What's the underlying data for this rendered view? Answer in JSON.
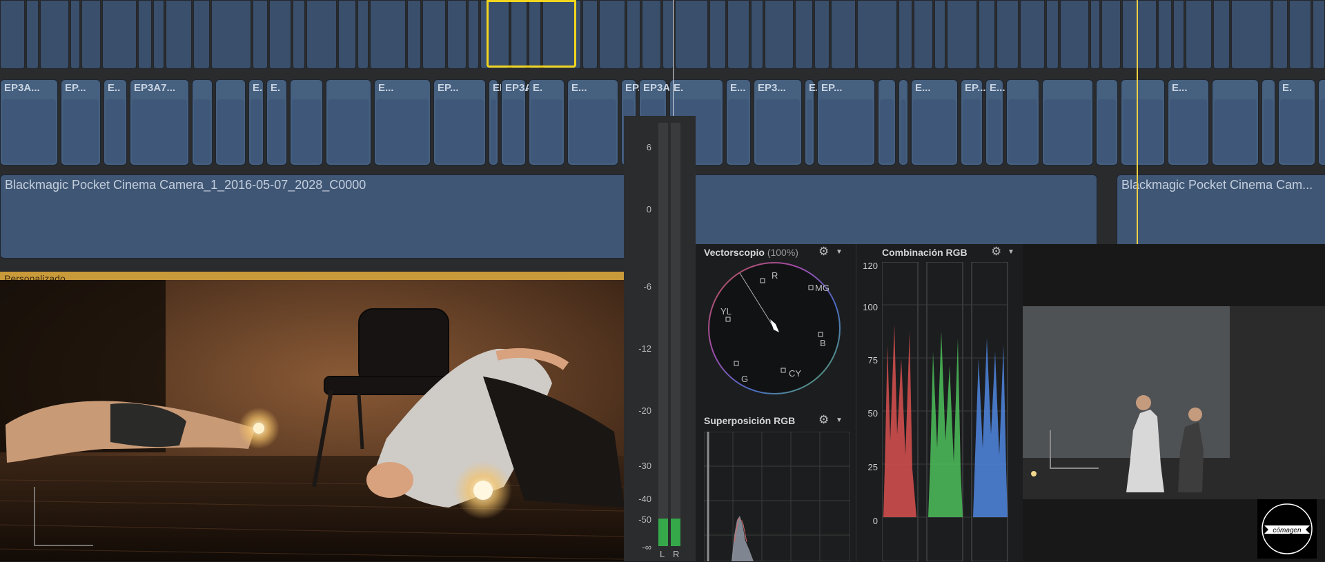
{
  "timeline": {
    "clip_labels": [
      "EP3A...",
      "EP...",
      "E..",
      "EP3A7...",
      "E.",
      "E.",
      "E...",
      "EP...",
      "EP3A...",
      "EP3A...",
      "E.",
      "E...",
      "EP...",
      "EP3A...",
      "E.",
      "E...",
      "EP3...",
      "E...",
      "EP...",
      "E...",
      "EP...",
      "E...",
      "E...",
      "E.",
      "EP..."
    ],
    "main_clip_label": "Blackmagic Pocket Cinema Camera_1_2016-05-07_2028_C0000",
    "second_clip_label": "Blackmagic Pocket Cinema Cam...",
    "band_label": "Personalizado"
  },
  "audio_meter": {
    "scale": [
      "6",
      "0",
      "-6",
      "-12",
      "-20",
      "-30",
      "-40",
      "-50",
      "-∞"
    ],
    "channels": [
      "L",
      "R"
    ]
  },
  "scopes": {
    "vectorscope": {
      "title": "Vectorscopio",
      "zoom": "(100%)",
      "targets": [
        "R",
        "MG",
        "YL",
        "B",
        "G",
        "CY"
      ]
    },
    "rgb_parade": {
      "title": "Combinación RGB",
      "scale": [
        "120",
        "100",
        "75",
        "50",
        "25",
        "0"
      ]
    },
    "rgb_overlay": {
      "title": "Superposición RGB"
    }
  },
  "logo": {
    "text": "cómagen"
  }
}
